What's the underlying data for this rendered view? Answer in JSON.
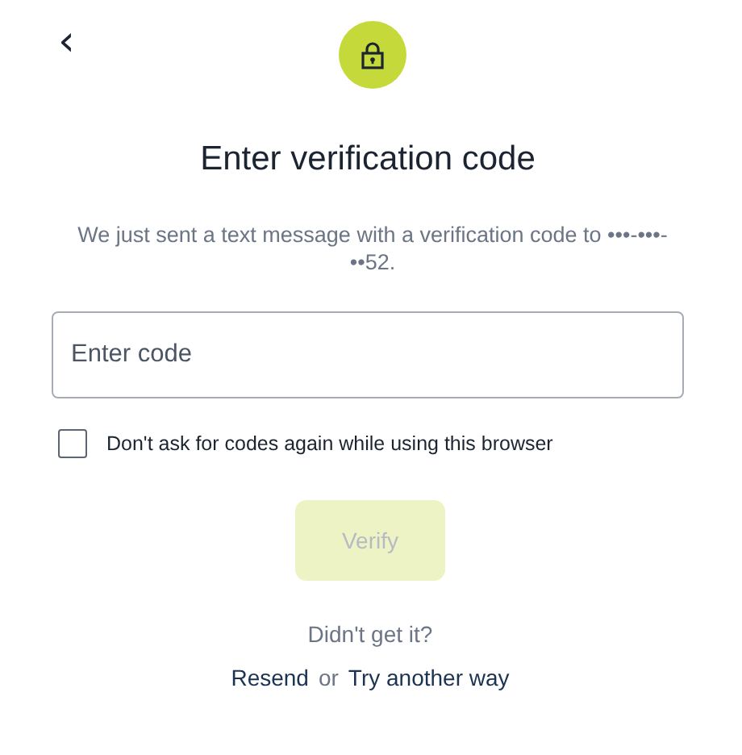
{
  "back_button": {
    "label": "‹"
  },
  "title": "Enter verification code",
  "message": "We just sent a text message with a verification code to •••-•••-••52.",
  "code_field": {
    "placeholder": "Enter code"
  },
  "remember_checkbox": {
    "label": "Don't ask for codes again while using this browser",
    "checked": false
  },
  "verify_button": {
    "label": "Verify",
    "disabled": true
  },
  "help_text": "Didn't get it?",
  "links": [
    {
      "kind": "link",
      "text": "Resend"
    },
    {
      "kind": "separator",
      "text": "or"
    },
    {
      "kind": "link",
      "text": "Try another way"
    }
  ]
}
